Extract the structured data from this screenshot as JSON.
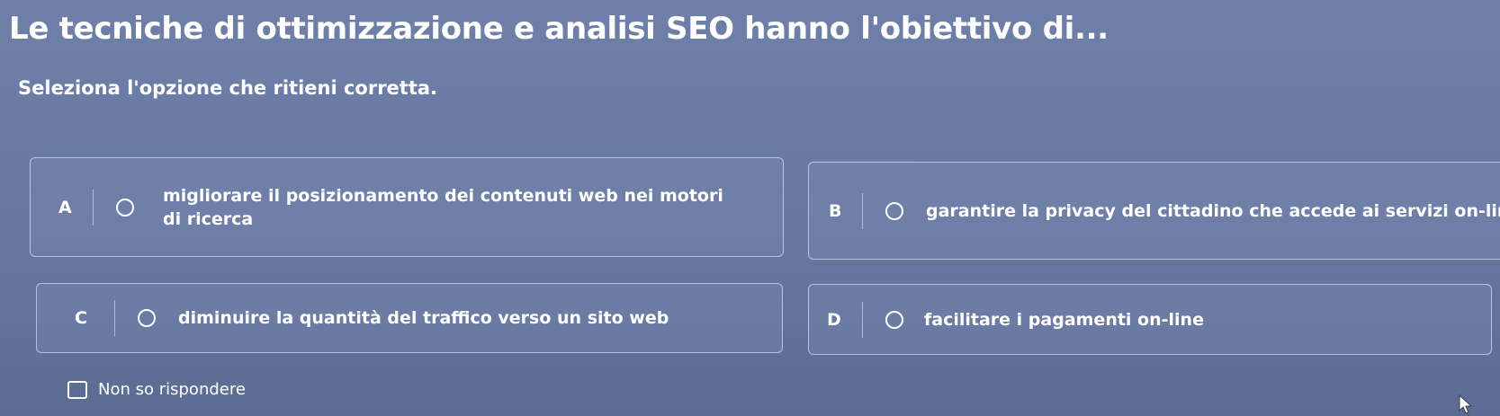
{
  "question": {
    "title": "Le tecniche di ottimizzazione e analisi SEO hanno l'obiettivo di...",
    "instruction": "Seleziona l'opzione che ritieni corretta."
  },
  "options": [
    {
      "letter": "A",
      "text": "migliorare il posizionamento dei contenuti web nei motori di ricerca",
      "selected": false
    },
    {
      "letter": "B",
      "text": "garantire la privacy del cittadino che accede ai servizi on-line",
      "selected": false
    },
    {
      "letter": "C",
      "text": "diminuire la quantità del traffico verso un sito web",
      "selected": false
    },
    {
      "letter": "D",
      "text": "facilitare i pagamenti on-line",
      "selected": false
    }
  ],
  "no_answer": {
    "label": "Non so rispondere",
    "checked": false
  },
  "icons": {
    "radio": "radio-empty-icon",
    "checkbox": "checkbox-empty-icon",
    "cursor": "mouse-pointer-icon"
  },
  "colors": {
    "background": "#6a7ba4",
    "text": "#ffffff",
    "border": "#e1e8f8"
  }
}
